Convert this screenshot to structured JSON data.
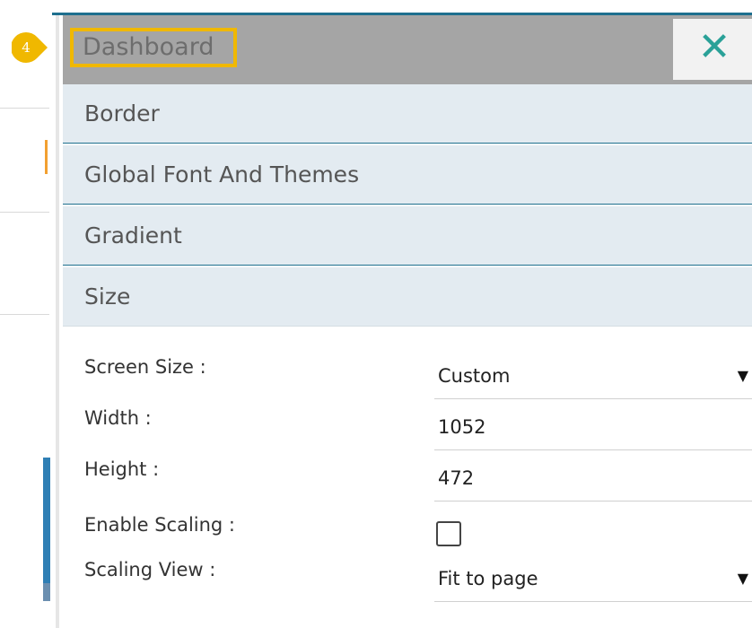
{
  "badge": {
    "number": "4"
  },
  "header": {
    "title": "Dashboard",
    "close_icon": "close-icon",
    "close_glyph": "✕"
  },
  "sections": [
    {
      "label": "Border"
    },
    {
      "label": "Global Font And Themes"
    },
    {
      "label": "Gradient"
    },
    {
      "label": "Size"
    }
  ],
  "size_form": {
    "screen_size": {
      "label": "Screen Size :",
      "value": "Custom"
    },
    "width": {
      "label": "Width :",
      "value": "1052"
    },
    "height": {
      "label": "Height :",
      "value": "472"
    },
    "enable_scaling": {
      "label": "Enable Scaling :",
      "checked": false
    },
    "scaling_view": {
      "label": "Scaling View :",
      "value": "Fit to page"
    }
  },
  "colors": {
    "accent": "#1e6f8e",
    "highlight": "#f0b800",
    "badge": "#f0b800",
    "close": "#2aa198",
    "section_bg": "#e3ebf1"
  }
}
